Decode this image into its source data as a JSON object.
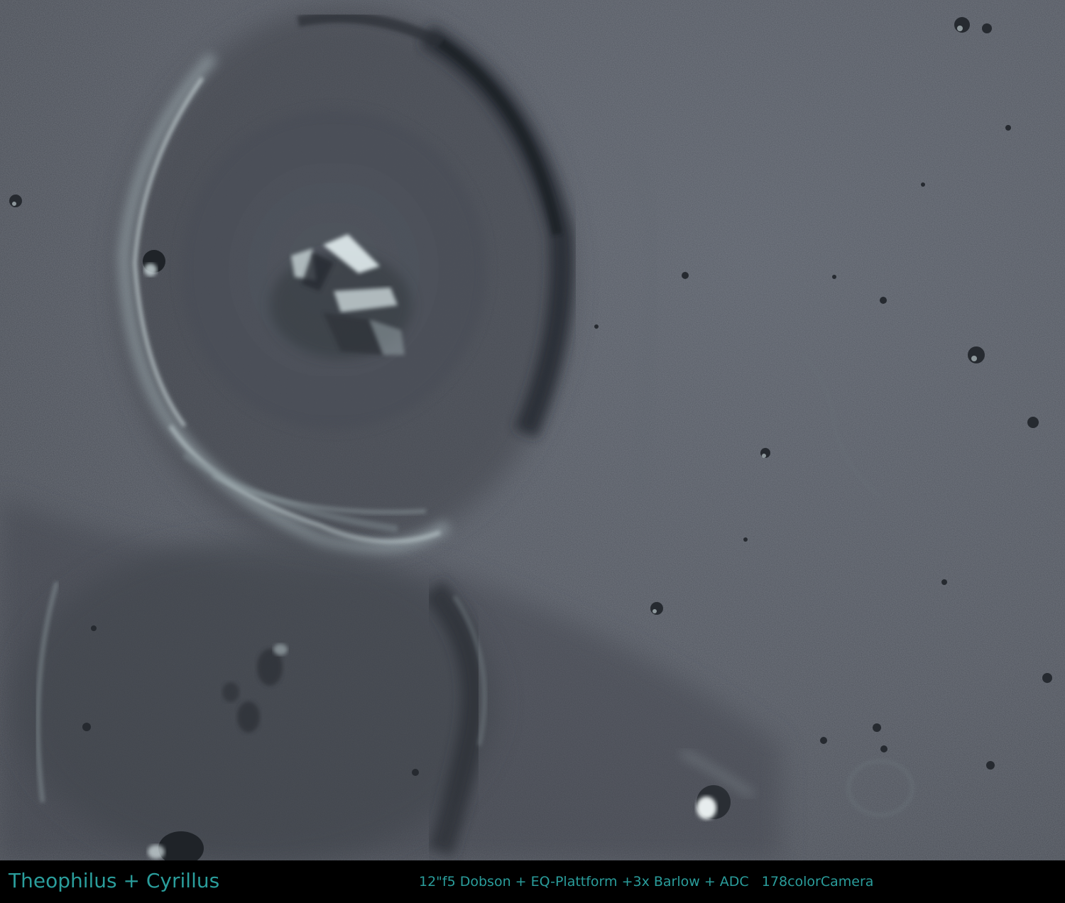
{
  "caption": {
    "title": "Theophilus + Cyrillus",
    "equipment": "12\"f5 Dobson + EQ-Plattform +3x Barlow + ADC   178colorCamera"
  },
  "colors": {
    "caption_text": "#2a9d9b",
    "caption_background": "#000000",
    "lunar_surface": "#4f545d",
    "lunar_shadow": "#2c3036",
    "lunar_highlight": "#c7d6d8"
  },
  "image": {
    "subject": "lunar craters Theophilus and Cyrillus",
    "type": "grayscale-blue telescope photograph"
  }
}
